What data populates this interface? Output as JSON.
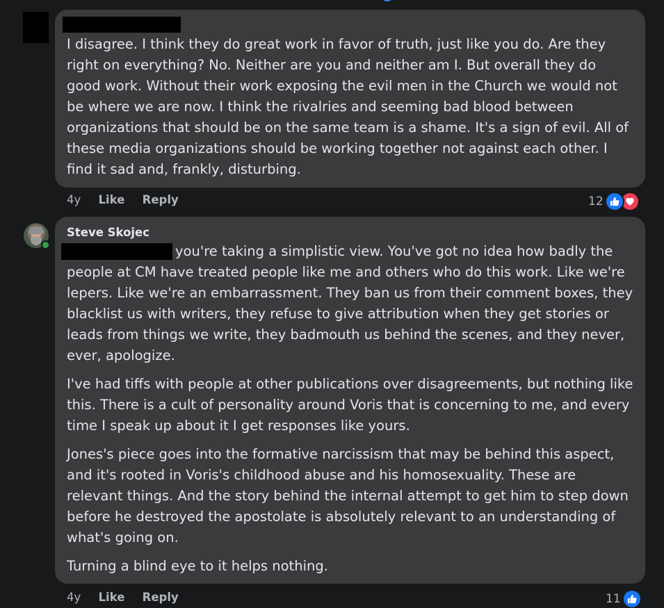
{
  "comments": [
    {
      "paragraphs": [
        "I disagree. I think they do great work in favor of truth, just like you do. Are they right on everything? No. Neither are you and neither am I. But overall they do good work. Without their work exposing the evil men in the Church we would not be where we are now. I think the rivalries and seeming bad blood between organizations that should be on the same team is a shame. It's a sign of evil. All of these media organizations should be working together not against each other. I find it sad and, frankly, disturbing."
      ],
      "time": "4y",
      "like_label": "Like",
      "reply_label": "Reply",
      "reaction_count": "12",
      "reactions": [
        "like-icon",
        "love-icon"
      ]
    },
    {
      "author": "Steve Skojec",
      "paragraphs": [
        "you're taking a simplistic view. You've got no idea how badly the people at CM have treated people like me and others who do this work. Like we're lepers. Like we're an embarrassment. They ban us from their comment boxes, they blacklist us with writers, they refuse to give attribution when they get stories or leads from things we write, they badmouth us behind the scenes, and they never, ever, apologize.",
        "I've had tiffs with people at other publications over disagreements, but nothing like this. There is a cult of personality around Voris that is concerning to me, and every time I speak up about it I get responses like yours.",
        "Jones's piece goes into the formative narcissism that may be behind this aspect, and it's rooted in Voris's childhood abuse and his homosexuality. These are relevant things. And the story behind the internal attempt to get him to step down before he destroyed the apostolate is absolutely relevant to an understanding of what's going on.",
        "Turning a blind eye to it helps nothing."
      ],
      "time": "4y",
      "like_label": "Like",
      "reply_label": "Reply",
      "reaction_count": "11",
      "reactions": [
        "like-icon"
      ]
    }
  ],
  "colors": {
    "background": "#18191a",
    "bubble": "#3a3b3c",
    "text": "#e4e6eb",
    "secondary_text": "#b0b3b8",
    "like_blue": "#1877f2",
    "love_red": "#f33e58",
    "online_green": "#31a24c"
  }
}
